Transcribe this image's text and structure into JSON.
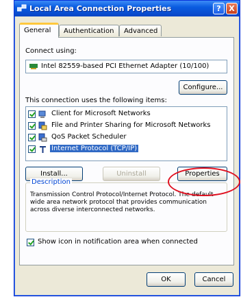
{
  "window": {
    "title": "Local Area Connection Properties",
    "help_button": "?",
    "close_button": "X"
  },
  "tabs": [
    {
      "label": "General",
      "active": true
    },
    {
      "label": "Authentication",
      "active": false
    },
    {
      "label": "Advanced",
      "active": false
    }
  ],
  "connect_using": {
    "label": "Connect using:",
    "adapter": "Intel 82559-based PCI Ethernet Adapter (10/100)",
    "configure_button": "Configure..."
  },
  "items": {
    "label": "This connection uses the following items:",
    "list": [
      {
        "label": "Client for Microsoft Networks",
        "checked": true,
        "selected": false,
        "icon": "network-client-icon"
      },
      {
        "label": "File and Printer Sharing for Microsoft Networks",
        "checked": true,
        "selected": false,
        "icon": "file-sharing-icon"
      },
      {
        "label": "QoS Packet Scheduler",
        "checked": true,
        "selected": false,
        "icon": "qos-icon"
      },
      {
        "label": "Internet Protocol (TCP/IP)",
        "checked": true,
        "selected": true,
        "icon": "protocol-icon"
      }
    ]
  },
  "buttons": {
    "install": "Install...",
    "uninstall": "Uninstall",
    "properties": "Properties"
  },
  "description": {
    "label": "Description",
    "text": "Transmission Control Protocol/Internet Protocol. The default wide area network protocol that provides communication across diverse interconnected networks."
  },
  "show_icon": {
    "label": "Show icon in notification area when connected",
    "checked": true
  },
  "footer": {
    "ok": "OK",
    "cancel": "Cancel"
  },
  "colors": {
    "titlebar": "#0a5ce0",
    "dialog_bg": "#ece9d8",
    "selection": "#316ac5",
    "highlight_circle": "#e01020"
  }
}
